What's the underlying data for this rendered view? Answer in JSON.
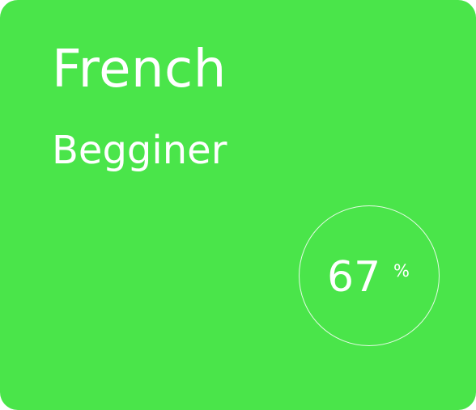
{
  "card": {
    "title": "French",
    "subtitle": "Begginer",
    "progress": {
      "value": "67",
      "unit": "%"
    },
    "colors": {
      "background": "#4ae54a",
      "text": "#ffffff"
    }
  }
}
